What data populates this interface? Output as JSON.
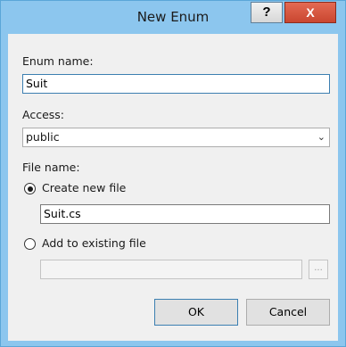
{
  "window": {
    "title": "New Enum",
    "help_label": "?",
    "close_label": "X"
  },
  "enum_name": {
    "label": "Enum name:",
    "value": "Suit"
  },
  "access": {
    "label": "Access:",
    "selected": "public"
  },
  "file_name": {
    "label": "File name:",
    "create_new_label": "Create new file",
    "create_new_checked": true,
    "new_file_value": "Suit.cs",
    "add_existing_label": "Add to existing file",
    "existing_file_value": "",
    "browse_label": "..."
  },
  "buttons": {
    "ok": "OK",
    "cancel": "Cancel"
  },
  "colors": {
    "frame": "#8cc6ee",
    "close_button": "#c94630",
    "focus_border": "#3c7fb1"
  }
}
